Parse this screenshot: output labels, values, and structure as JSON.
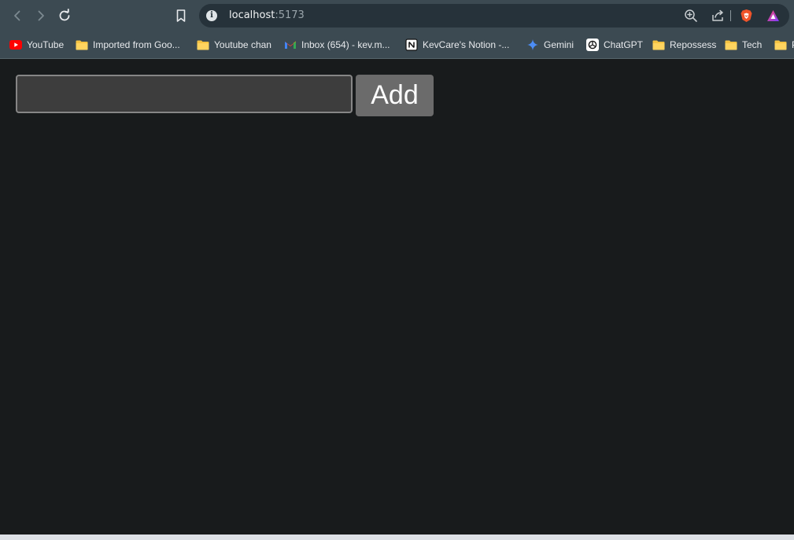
{
  "browser": {
    "url_host": "localhost",
    "url_port": ":5173",
    "info_glyph": "i",
    "icons": {
      "back": "chevron-left-icon",
      "forward": "chevron-right-icon",
      "reload": "reload-icon",
      "bookmark": "bookmark-icon",
      "site_info": "info-icon",
      "zoom": "zoom-in-icon",
      "share": "share-icon",
      "brave": "brave-shield-icon",
      "rewards": "brave-rewards-icon"
    }
  },
  "bookmarks": [
    {
      "label": "YouTube",
      "icon": "youtube-icon"
    },
    {
      "label": "Imported from Goo...",
      "icon": "folder-icon"
    },
    {
      "label": "Youtube chan",
      "icon": "folder-icon"
    },
    {
      "label": "Inbox (654) - kev.m...",
      "icon": "gmail-icon"
    },
    {
      "label": "KevCare's Notion -...",
      "icon": "notion-icon"
    },
    {
      "label": "Gemini",
      "icon": "gemini-icon"
    },
    {
      "label": "ChatGPT",
      "icon": "chatgpt-icon"
    },
    {
      "label": "Repossess",
      "icon": "folder-icon"
    },
    {
      "label": "Tech",
      "icon": "folder-icon"
    },
    {
      "label": "P",
      "icon": "folder-icon"
    }
  ],
  "page": {
    "input_value": "",
    "input_placeholder": "",
    "add_label": "Add"
  },
  "colors": {
    "chrome": "#3c4a52",
    "url_bar": "#26323a",
    "page_bg": "#181b1c",
    "input_bg": "#3d3d3d",
    "button_bg": "#6b6b6b",
    "folder": "#f5c342"
  }
}
